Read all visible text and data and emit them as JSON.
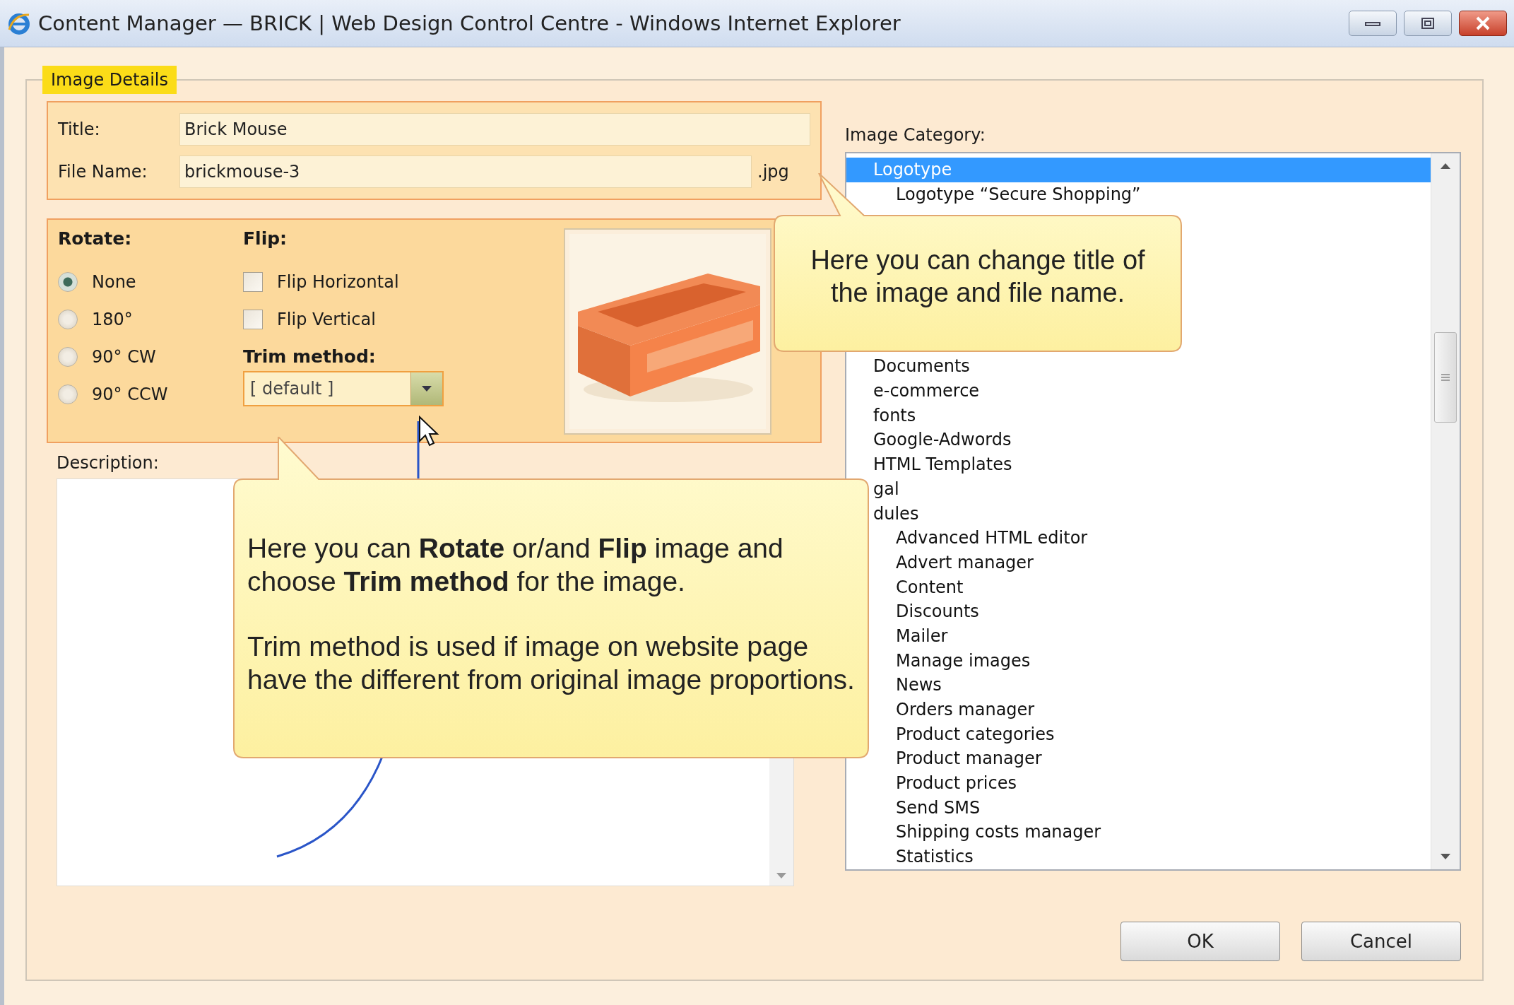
{
  "window": {
    "title": "Content Manager — BRICK | Web Design Control Centre - Windows Internet Explorer"
  },
  "legend": "Image Details",
  "title_field": {
    "label": "Title:",
    "value": "Brick Mouse"
  },
  "file_name_field": {
    "label": "File Name:",
    "value": "brickmouse-3",
    "extension": ".jpg"
  },
  "rotate": {
    "heading": "Rotate:",
    "options": [
      {
        "label": "None",
        "selected": true
      },
      {
        "label": "180°",
        "selected": false
      },
      {
        "label": "90° CW",
        "selected": false
      },
      {
        "label": "90° CCW",
        "selected": false
      }
    ]
  },
  "flip": {
    "heading": "Flip:",
    "options": [
      {
        "label": "Flip Horizontal",
        "checked": false
      },
      {
        "label": "Flip Vertical",
        "checked": false
      }
    ]
  },
  "trim": {
    "heading": "Trim method:",
    "value": "[ default ]"
  },
  "description": {
    "label": "Description:"
  },
  "category": {
    "label": "Image Category:",
    "items": [
      {
        "label": "Logotype",
        "selected": true,
        "children": [
          {
            "label": "Logotype “Secure Shopping”",
            "selected": false
          }
        ]
      },
      {
        "label": "Documents",
        "selected": false
      },
      {
        "label": "e-commerce",
        "selected": false
      },
      {
        "label": "fonts",
        "selected": false
      },
      {
        "label": "Google-Adwords",
        "selected": false
      },
      {
        "label": "HTML Templates",
        "selected": false
      },
      {
        "label": "gal",
        "selected": false
      },
      {
        "label": "dules",
        "selected": false,
        "children": [
          {
            "label": "Advanced HTML editor",
            "selected": false
          },
          {
            "label": "Advert manager",
            "selected": false
          },
          {
            "label": "Content",
            "selected": false
          },
          {
            "label": "Discounts",
            "selected": false
          },
          {
            "label": "Mailer",
            "selected": false
          },
          {
            "label": "Manage images",
            "selected": false
          },
          {
            "label": "News",
            "selected": false
          },
          {
            "label": "Orders manager",
            "selected": false
          },
          {
            "label": "Product categories",
            "selected": false
          },
          {
            "label": "Product manager",
            "selected": false
          },
          {
            "label": "Product prices",
            "selected": false
          },
          {
            "label": "Send SMS",
            "selected": false
          },
          {
            "label": "Shipping costs manager",
            "selected": false
          },
          {
            "label": "Statistics",
            "selected": false
          }
        ]
      }
    ]
  },
  "buttons": [
    {
      "label": "OK"
    },
    {
      "label": "Cancel"
    }
  ],
  "callouts": [
    {
      "paragraphs": [
        "Here you can change title of the image and file name."
      ]
    },
    {
      "paragraphs": [
        "Here you can **Rotate** or/and **Flip** image and choose **Trim method** for the image.",
        "Trim method is used if image on website page have the different from original image proportions."
      ]
    }
  ]
}
